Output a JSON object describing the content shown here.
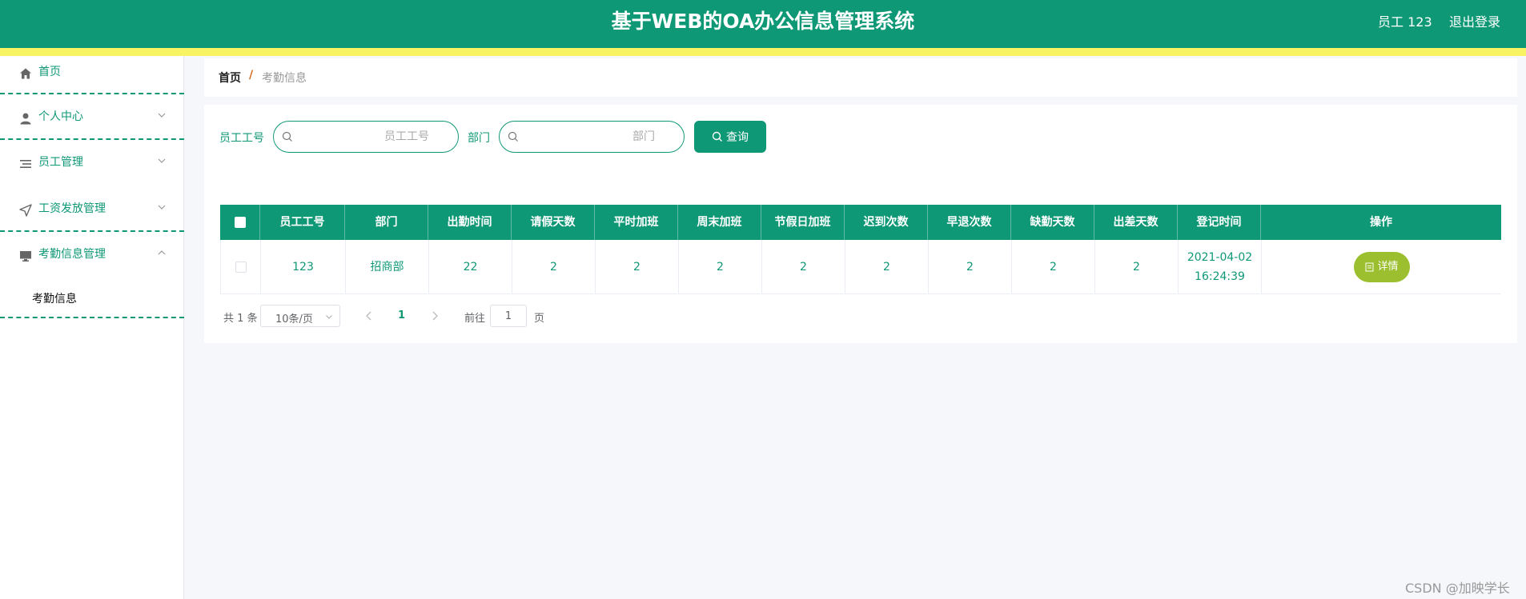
{
  "header": {
    "title": "基于WEB的OA办公信息管理系统",
    "user": "员工 123",
    "logout": "退出登录",
    "colors": {
      "primary": "#0f9876",
      "stripe": "#f7f363",
      "detail_button": "#9bbf2e"
    }
  },
  "sidebar": {
    "items": [
      {
        "label": "首页",
        "icon": "home-icon"
      },
      {
        "label": "个人中心",
        "icon": "user-icon"
      },
      {
        "label": "员工管理",
        "icon": "list-icon"
      },
      {
        "label": "工资发放管理",
        "icon": "send-icon"
      },
      {
        "label": "考勤信息管理",
        "icon": "monitor-icon"
      }
    ],
    "submenu": {
      "label": "考勤信息"
    }
  },
  "breadcrumb": {
    "home": "首页",
    "separator": "/",
    "current": "考勤信息"
  },
  "search": {
    "employee_label": "员工工号",
    "employee_placeholder": "员工工号",
    "employee_value": "",
    "dept_label": "部门",
    "dept_placeholder": "部门",
    "dept_value": "",
    "query_button": "查询"
  },
  "table": {
    "columns": [
      "员工工号",
      "部门",
      "出勤时间",
      "请假天数",
      "平时加班",
      "周末加班",
      "节假日加班",
      "迟到次数",
      "早退次数",
      "缺勤天数",
      "出差天数",
      "登记时间",
      "操作"
    ],
    "rows": [
      {
        "cells": [
          "123",
          "招商部",
          "22",
          "2",
          "2",
          "2",
          "2",
          "2",
          "2",
          "2",
          "2"
        ],
        "date": "2021-04-02",
        "time": "16:24:39",
        "action": "详情"
      }
    ]
  },
  "pagination": {
    "total_prefix": "共",
    "total": "1",
    "total_suffix": "条",
    "page_size": "10条/页",
    "current_page": "1",
    "goto_label": "前往",
    "goto_value": "1",
    "page_suffix": "页"
  },
  "watermark": "CSDN @加映学长"
}
